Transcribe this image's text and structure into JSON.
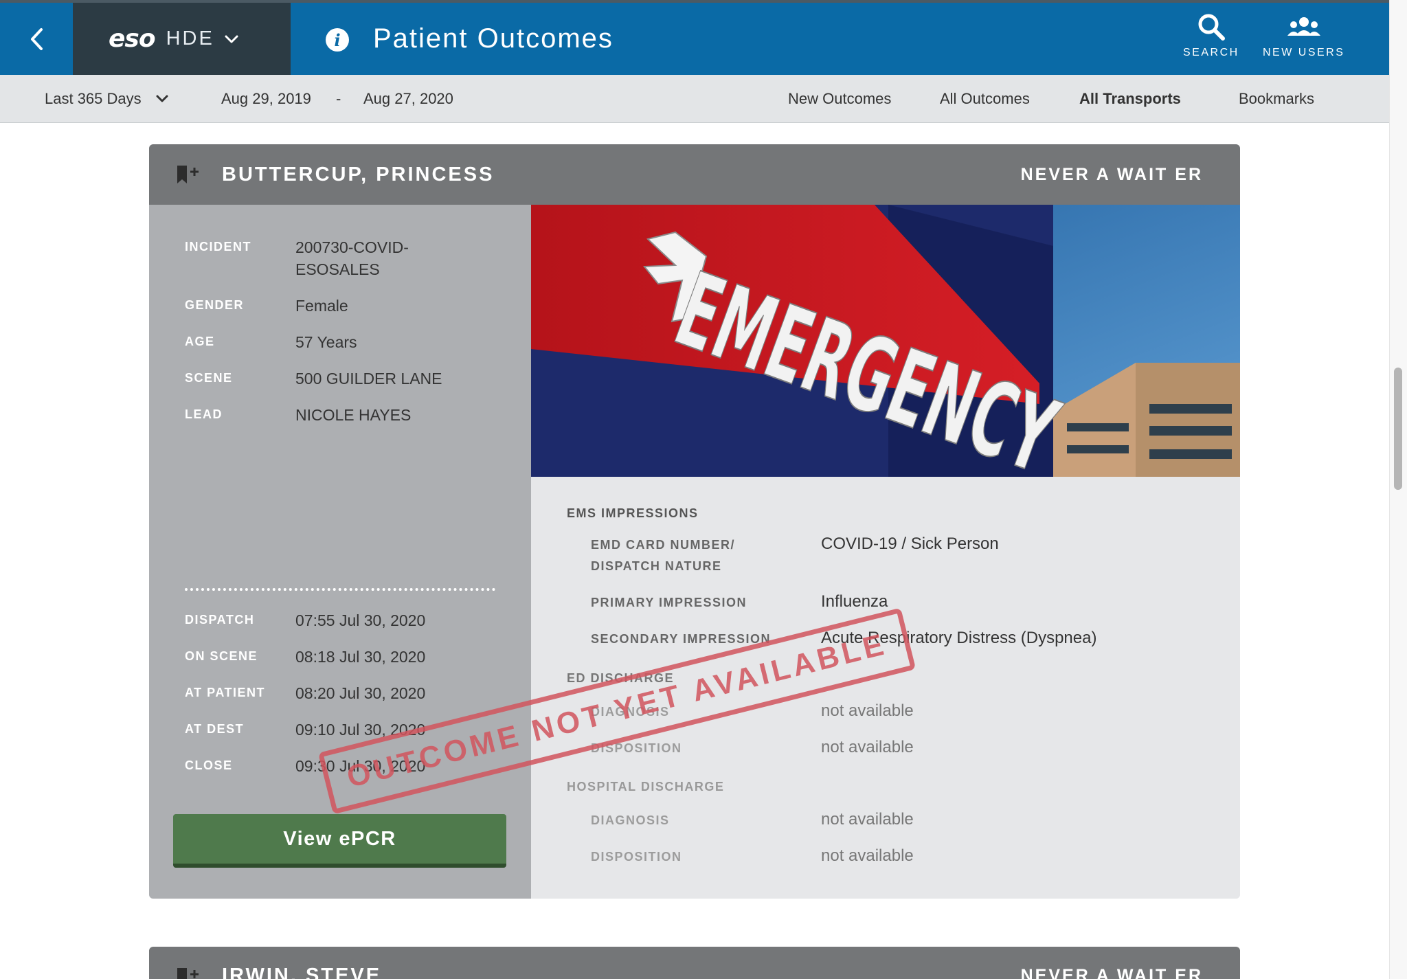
{
  "header": {
    "brand_logo": "eso",
    "brand_product": "HDE",
    "title": "Patient Outcomes",
    "search_label": "SEARCH",
    "new_users_label": "NEW USERS"
  },
  "filters": {
    "range": "Last 365 Days",
    "date_from": "Aug 29, 2019",
    "date_separator": "-",
    "date_to": "Aug 27, 2020"
  },
  "nav": {
    "new_outcomes": "New Outcomes",
    "all_outcomes": "All Outcomes",
    "all_transports": "All Transports",
    "bookmarks": "Bookmarks",
    "active": "all_transports"
  },
  "card": {
    "patient_name": "BUTTERCUP, PRINCESS",
    "facility": "NEVER A WAIT ER",
    "photo_sign_text": "EMERGENCY",
    "incident": {
      "label": "INCIDENT",
      "value": "200730-COVID-ESOSALES"
    },
    "gender": {
      "label": "GENDER",
      "value": "Female"
    },
    "age": {
      "label": "AGE",
      "value": "57 Years"
    },
    "scene": {
      "label": "SCENE",
      "value": "500 GUILDER LANE"
    },
    "lead": {
      "label": "LEAD",
      "value": "NICOLE HAYES"
    },
    "dispatch": {
      "label": "DISPATCH",
      "value": "07:55 Jul 30, 2020"
    },
    "on_scene": {
      "label": "ON SCENE",
      "value": "08:18 Jul 30, 2020"
    },
    "at_patient": {
      "label": "AT PATIENT",
      "value": "08:20 Jul 30, 2020"
    },
    "at_dest": {
      "label": "AT DEST",
      "value": "09:10 Jul 30, 2020"
    },
    "close": {
      "label": "CLOSE",
      "value": "09:30 Jul 30, 2020"
    },
    "view_epcr": "View ePCR",
    "ems_impressions": {
      "title": "EMS IMPRESSIONS",
      "emd_label": "EMD CARD NUMBER/ DISPATCH NATURE",
      "emd_value": "COVID-19 / Sick Person",
      "primary_label": "PRIMARY IMPRESSION",
      "primary_value": "Influenza",
      "secondary_label": "SECONDARY IMPRESSION",
      "secondary_value": "Acute Respiratory Distress (Dyspnea)"
    },
    "ed_discharge": {
      "title": "ED DISCHARGE",
      "diagnosis_label": "DIAGNOSIS",
      "diagnosis_value": "not available",
      "disposition_label": "DISPOSITION",
      "disposition_value": "not available"
    },
    "hospital_discharge": {
      "title": "HOSPITAL DISCHARGE",
      "diagnosis_label": "DIAGNOSIS",
      "diagnosis_value": "not available",
      "disposition_label": "DISPOSITION",
      "disposition_value": "not available"
    },
    "stamp": "OUTCOME NOT YET AVAILABLE"
  },
  "next_card": {
    "patient_name": "IRWIN, STEVE",
    "facility": "NEVER A WAIT ER"
  },
  "colors": {
    "header_blue": "#0a6aa6",
    "brand_dark": "#2c3b44",
    "button_green": "#4f7a4c",
    "stamp_red": "#d2555e"
  }
}
